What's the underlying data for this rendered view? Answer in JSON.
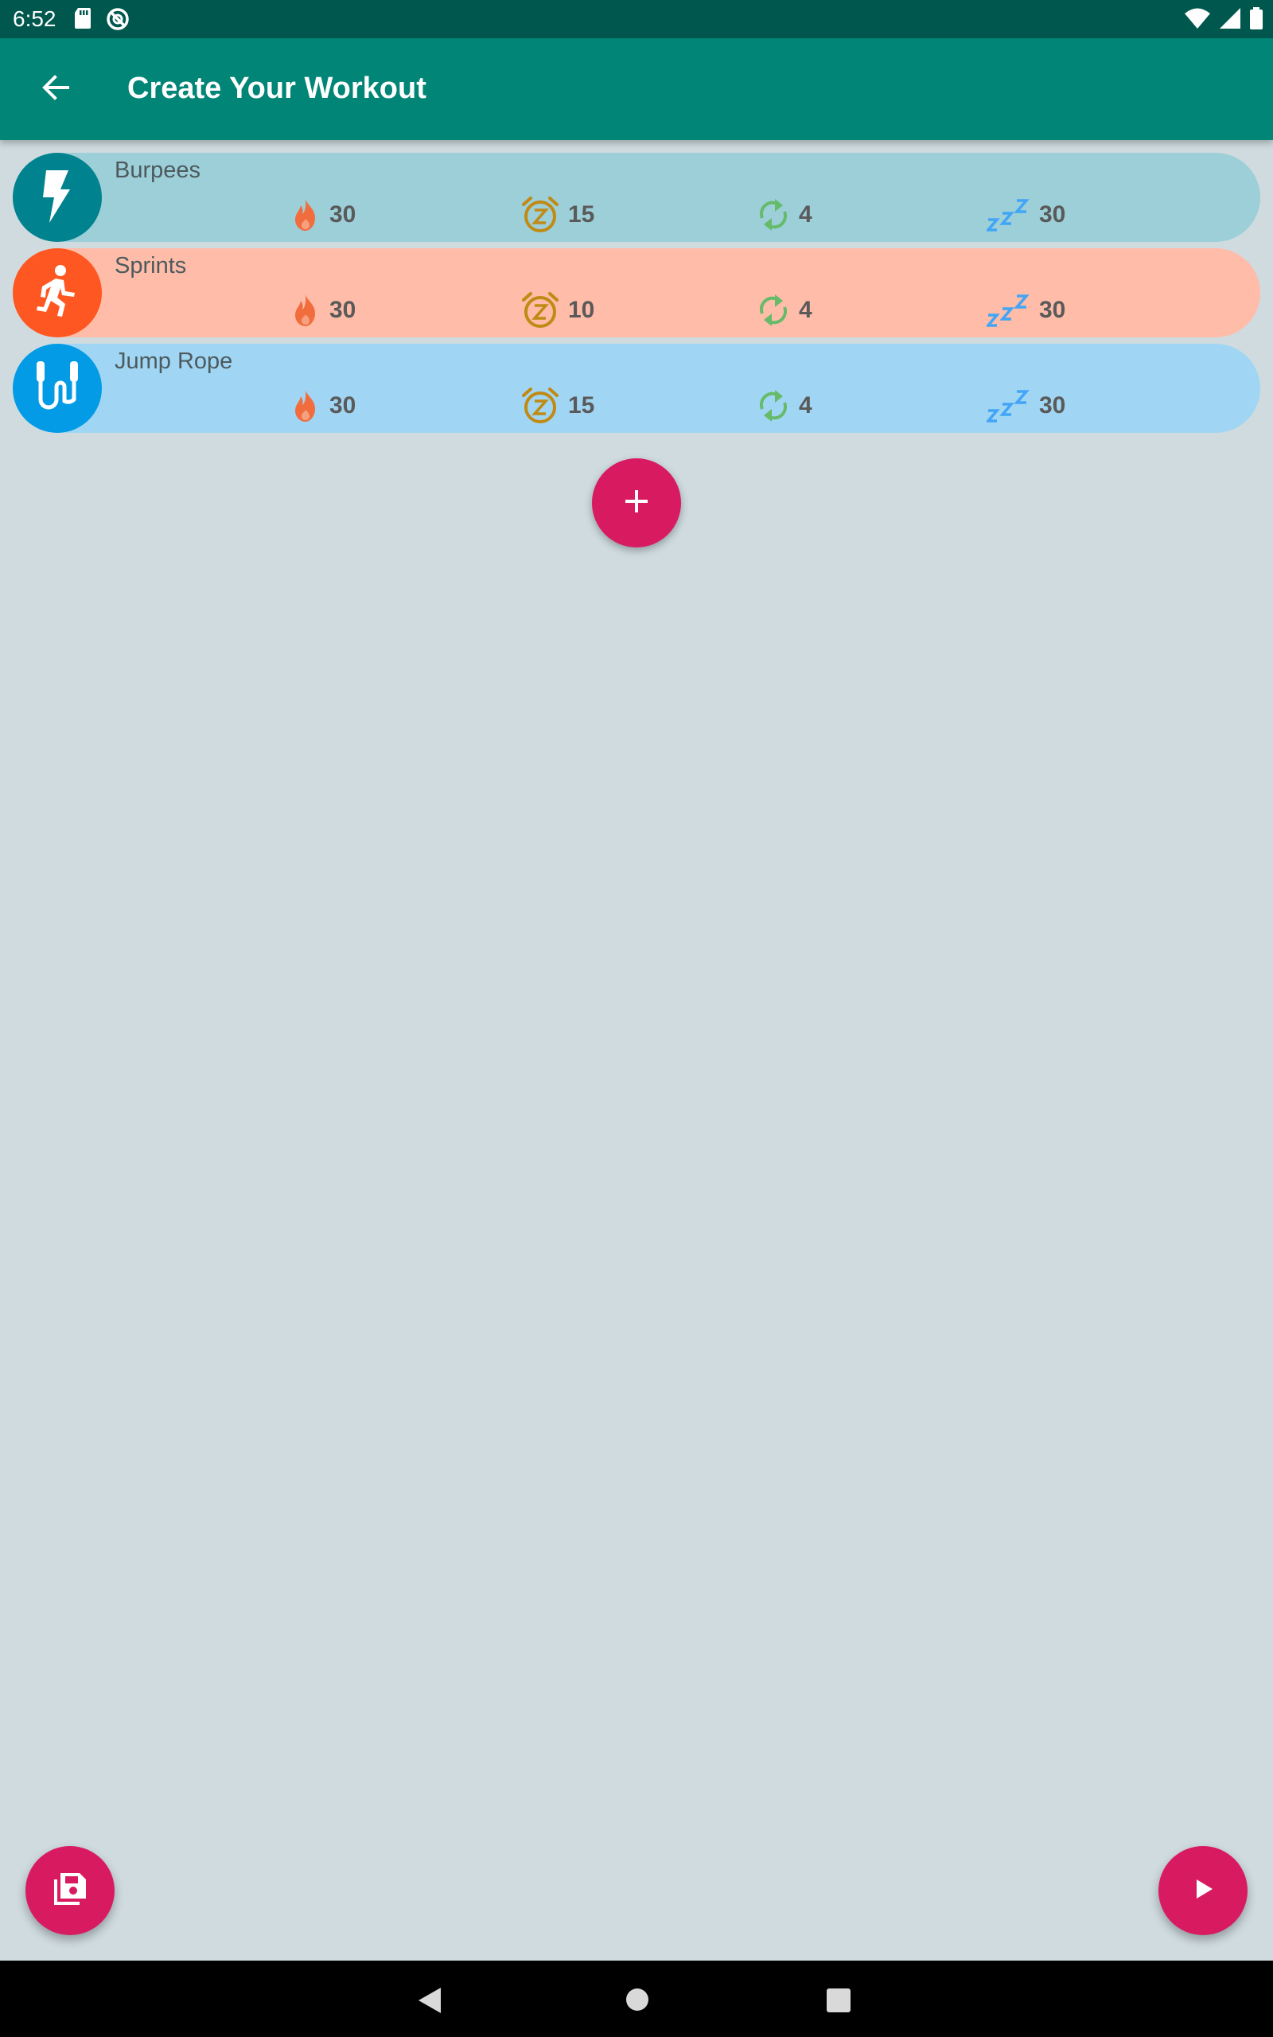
{
  "status_bar": {
    "time": "6:52",
    "icons_left": [
      "sd-card-icon",
      "sync-blocked-icon"
    ],
    "icons_right": [
      "wifi-icon",
      "cell-signal-icon",
      "battery-icon"
    ]
  },
  "app_bar": {
    "title": "Create Your Workout",
    "back_icon": "arrow-back-icon"
  },
  "colors": {
    "status_bar": "#00574e",
    "app_bar": "#018576",
    "background": "#cfdbdf",
    "fab": "#d81b60",
    "calories_icon": "#f26d3d",
    "duration_icon": "#c08a14",
    "repeats_icon": "#66bb6a",
    "rest_icon": "#42a5f5"
  },
  "exercises": [
    {
      "name": "Burpees",
      "icon": "lightning-bolt-icon",
      "row_color": "#9ccfd8",
      "avatar_color": "#00838f",
      "calories": "30",
      "duration": "15",
      "repeats": "4",
      "rest": "30"
    },
    {
      "name": "Sprints",
      "icon": "running-person-icon",
      "row_color": "#ffbca8",
      "avatar_color": "#ff5722",
      "calories": "30",
      "duration": "10",
      "repeats": "4",
      "rest": "30"
    },
    {
      "name": "Jump Rope",
      "icon": "jump-rope-icon",
      "row_color": "#a0d6f3",
      "avatar_color": "#039be5",
      "calories": "30",
      "duration": "15",
      "repeats": "4",
      "rest": "30"
    }
  ],
  "stat_icons": {
    "calories": "fire-icon",
    "duration": "alarm-snooze-icon",
    "repeats": "repeat-icon",
    "rest": "sleep-zzz-icon"
  },
  "actions": {
    "add_icon": "plus-icon",
    "save_icon": "save-floppy-icon",
    "play_icon": "play-icon"
  },
  "nav_bar": {
    "back_icon": "nav-back-triangle-icon",
    "home_icon": "nav-home-circle-icon",
    "recents_icon": "nav-recents-square-icon"
  }
}
